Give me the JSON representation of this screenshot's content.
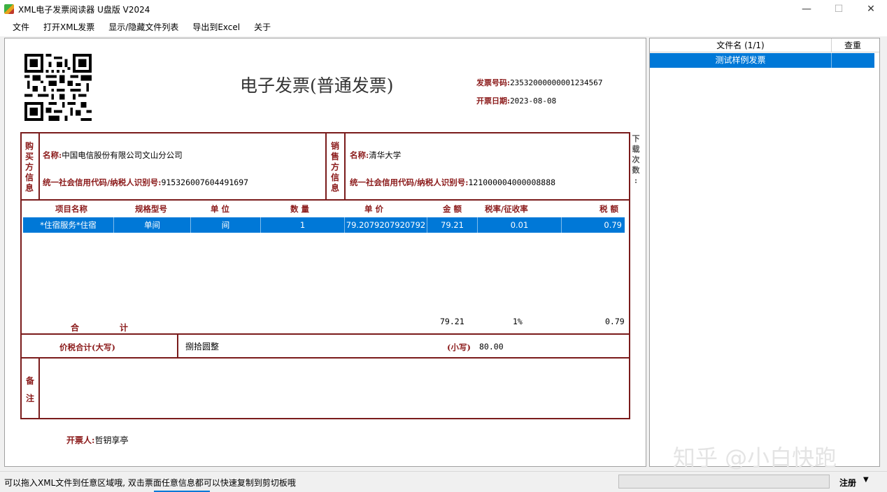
{
  "window": {
    "title": "XML电子发票阅读器  U盘版 V2024",
    "minimize": "—",
    "maximize": "☐",
    "close": "✕"
  },
  "menu": [
    "文件",
    "打开XML发票",
    "显示/隐藏文件列表",
    "导出到Excel",
    "关于"
  ],
  "invoice": {
    "title": "电子发票(普通发票)",
    "number_label": "发票号码:",
    "number": "23532000000001234567",
    "date_label": "开票日期:",
    "date": "2023-08-08",
    "buyer_vlabel": [
      "购",
      "买",
      "方",
      "信",
      "息"
    ],
    "seller_vlabel": [
      "销",
      "售",
      "方",
      "信",
      "息"
    ],
    "name_label": "名称:",
    "taxid_label": "统一社会信用代码/纳税人识别号:",
    "buyer_name": "中国电信股份有限公司文山分公司",
    "buyer_taxid": "915326007604491697",
    "seller_name": "清华大学",
    "seller_taxid": "121000004000008888",
    "columns": [
      "项目名称",
      "规格型号",
      "单 位",
      "数 量",
      "单 价",
      "金 额",
      "税率/征收率",
      "税 额"
    ],
    "items": [
      {
        "name": "*住宿服务*住宿",
        "spec": "单间",
        "unit": "间",
        "qty": "1",
        "price": "79.2079207920792",
        "amount": "79.21",
        "rate": "0.01",
        "tax": "0.79"
      }
    ],
    "total_label_1": "合",
    "total_label_2": "计",
    "total_amount": "79.21",
    "total_rate": "1%",
    "total_tax": "0.79",
    "sum_label": "价税合计(大写)",
    "sum_words": "捌拾圆整",
    "sum_small_label": "(小写)",
    "sum_small": "80.00",
    "remark_vlabel": [
      "备",
      "注"
    ],
    "issuer_label": "开票人:",
    "issuer": "哲钥享亭",
    "download_vlabel": [
      "下",
      "载",
      "次",
      "数",
      ":"
    ]
  },
  "file_list": {
    "col_name": "文件名 (1/1)",
    "col_dup": "查重",
    "rows": [
      {
        "name": "测试样例发票",
        "dup": ""
      }
    ]
  },
  "watermark": "知乎 @小白快跑",
  "status": {
    "hint": "可以拖入XML文件到任意区域哦, 双击票面任意信息都可以快速复制到剪切板哦",
    "register": "注册",
    "register_arrow": "▼"
  },
  "colors": {
    "accent_red": "#7a1b1b",
    "selection_blue": "#0078d7"
  }
}
